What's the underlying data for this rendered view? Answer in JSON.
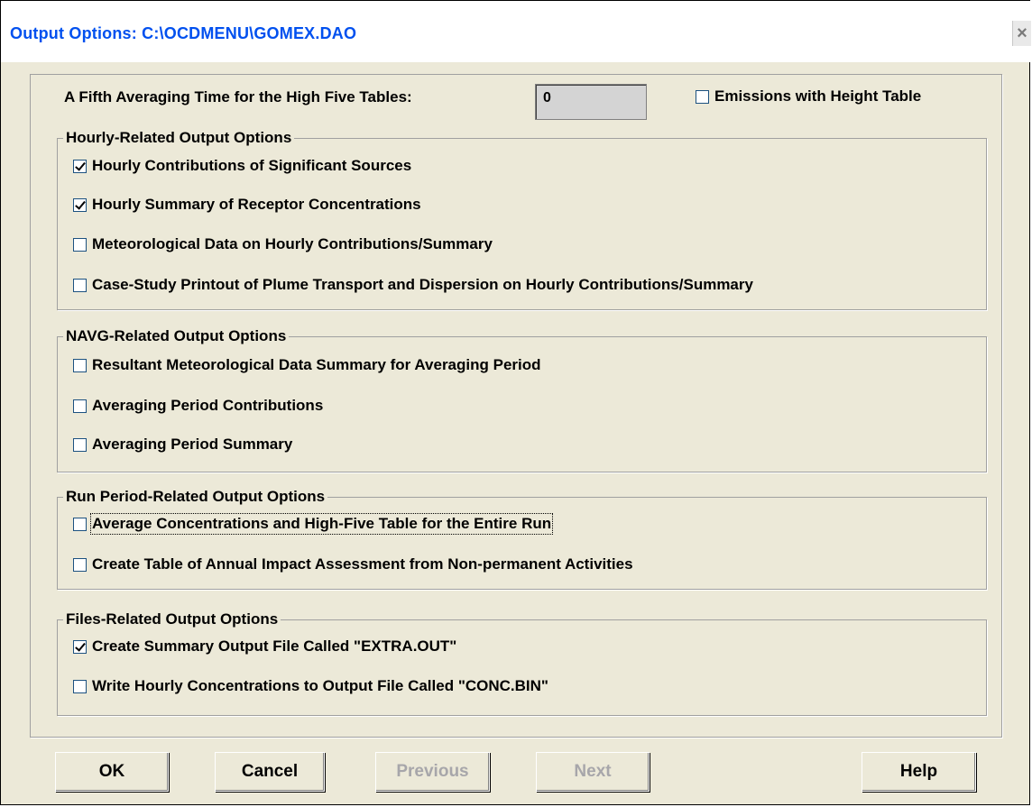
{
  "window": {
    "title": "Output Options: C:\\OCDMENU\\GOMEX.DAO",
    "close_glyph": "×"
  },
  "top": {
    "fifth_avg_label": "A Fifth Averaging Time for the High Five Tables:",
    "fifth_avg_value": "0",
    "emissions_label": "Emissions with Height Table",
    "emissions_checked": false
  },
  "groups": {
    "hourly": {
      "title": "Hourly-Related Output Options",
      "items": [
        {
          "label": "Hourly Contributions of Significant Sources",
          "checked": true
        },
        {
          "label": "Hourly Summary of Receptor Concentrations",
          "checked": true
        },
        {
          "label": "Meteorological Data on Hourly Contributions/Summary",
          "checked": false
        },
        {
          "label": "Case-Study Printout of Plume Transport and Dispersion on Hourly Contributions/Summary",
          "checked": false
        }
      ]
    },
    "navg": {
      "title": "NAVG-Related Output Options",
      "items": [
        {
          "label": "Resultant Meteorological Data Summary for Averaging Period",
          "checked": false
        },
        {
          "label": "Averaging Period Contributions",
          "checked": false
        },
        {
          "label": "Averaging Period Summary",
          "checked": false
        }
      ]
    },
    "run": {
      "title": "Run Period-Related Output Options",
      "items": [
        {
          "label": "Average Concentrations and High-Five Table for the Entire Run",
          "checked": false
        },
        {
          "label": "Create Table of Annual Impact Assessment from Non-permanent Activities",
          "checked": false
        }
      ]
    },
    "files": {
      "title": "Files-Related Output Options",
      "items": [
        {
          "label": "Create Summary Output File Called \"EXTRA.OUT\"",
          "checked": true
        },
        {
          "label": "Write Hourly Concentrations to Output File Called \"CONC.BIN\"",
          "checked": false
        }
      ]
    }
  },
  "buttons": {
    "ok": "OK",
    "cancel": "Cancel",
    "previous": "Previous",
    "next": "Next",
    "help": "Help"
  },
  "colors": {
    "title_text": "#0050ef",
    "dialog_bg": "#ece9d8",
    "disabled_text": "#a7a6aa"
  }
}
